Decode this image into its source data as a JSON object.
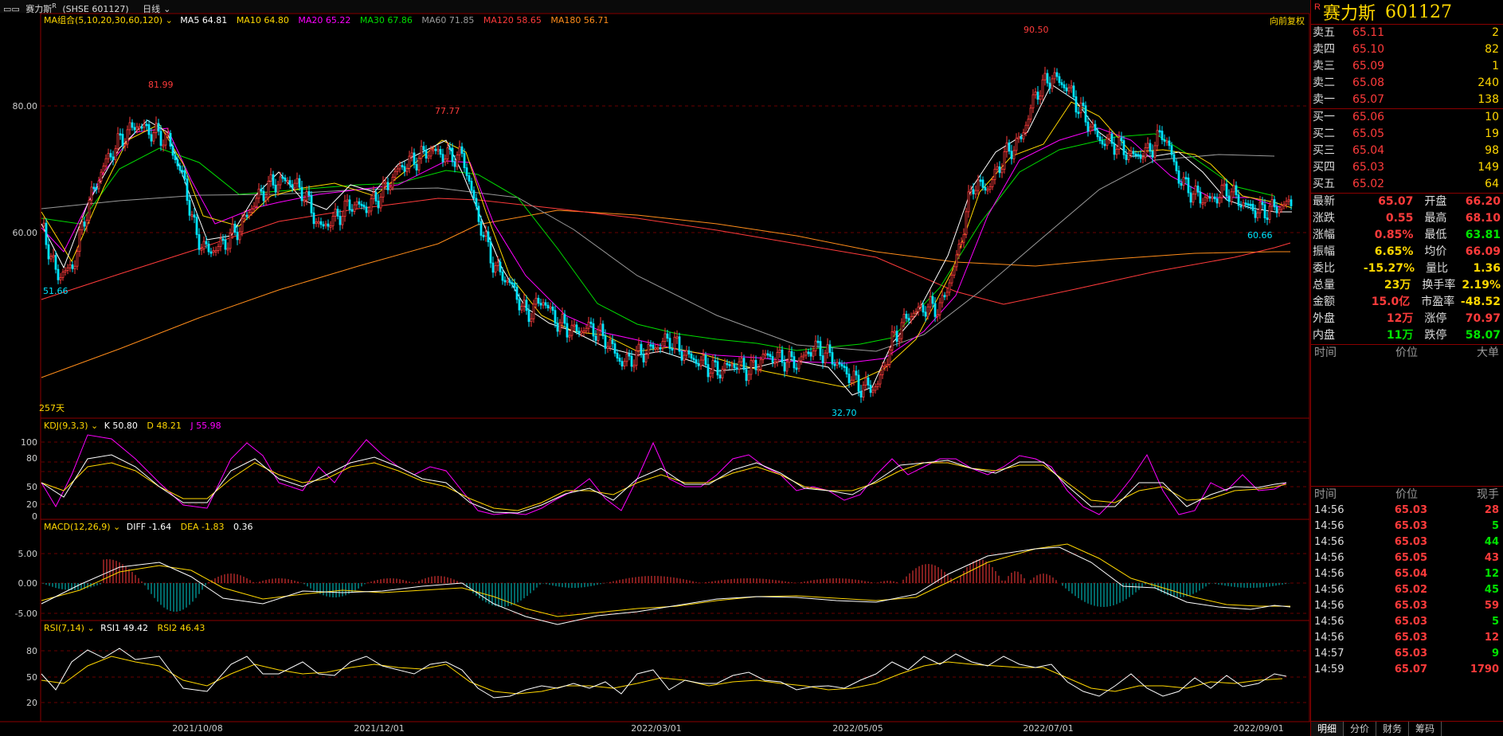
{
  "topbar": {
    "title": "赛力斯",
    "sup": "R",
    "exchange": "(SHSE 601127)",
    "period": "日线"
  },
  "main_chart": {
    "ma_group": "MA组合(5,10,20,30,60,120)",
    "ma": [
      {
        "name": "MA5",
        "value": "64.81",
        "color": "#ffffff"
      },
      {
        "name": "MA10",
        "value": "64.80",
        "color": "#ffd700"
      },
      {
        "name": "MA20",
        "value": "65.22",
        "color": "#ff00ff"
      },
      {
        "name": "MA30",
        "value": "67.86",
        "color": "#00dd00"
      },
      {
        "name": "MA60",
        "value": "71.85",
        "color": "#9a9a9a"
      },
      {
        "name": "MA120",
        "value": "58.65",
        "color": "#ff3b3b"
      },
      {
        "name": "MA180",
        "value": "56.71",
        "color": "#ff8c1a"
      }
    ],
    "adjust": "向前复权",
    "days": "257天",
    "y_labels": [
      "80.00",
      "60.00"
    ],
    "peaks": {
      "p1": "81.99",
      "p2": "77.77",
      "p3": "90.50",
      "low1": "51.66",
      "low2": "32.70",
      "last_low": "60.66"
    },
    "x_labels": [
      "2021/10/08",
      "2021/12/01",
      "2022/03/01",
      "2022/05/05",
      "2022/07/01",
      "2022/09/01"
    ]
  },
  "kdj": {
    "title": "KDJ(9,3,3)",
    "k": "K 50.80",
    "d": "D 48.21",
    "j": "J 55.98",
    "y_labels": [
      "100",
      "80",
      "50",
      "20",
      "0"
    ]
  },
  "macd": {
    "title": "MACD(12,26,9)",
    "diff": "DIFF -1.64",
    "dea": "DEA -1.83",
    "macd": "0.36",
    "y_labels": [
      "5.00",
      "0.00",
      "-5.00"
    ]
  },
  "rsi": {
    "title": "RSI(7,14)",
    "rsi1": "RSI1 49.42",
    "rsi2": "RSI2 46.43",
    "y_labels": [
      "80",
      "50",
      "20"
    ]
  },
  "chart_data": {
    "type": "candlestick",
    "ylim": [
      32.7,
      90.5
    ],
    "series": [
      {
        "name": "MA5",
        "values": [
          64.81
        ]
      },
      {
        "name": "MA10",
        "values": [
          64.8
        ]
      },
      {
        "name": "MA20",
        "values": [
          65.22
        ]
      },
      {
        "name": "MA30",
        "values": [
          67.86
        ]
      },
      {
        "name": "MA60",
        "values": [
          71.85
        ]
      },
      {
        "name": "MA120",
        "values": [
          58.65
        ]
      },
      {
        "name": "MA180",
        "values": [
          56.71
        ]
      }
    ],
    "highs": [
      81.99,
      77.77,
      90.5
    ],
    "lows": [
      51.66,
      32.7,
      60.66
    ]
  },
  "stock": {
    "sup": "R",
    "name": "赛力斯",
    "code": "601127"
  },
  "orderbook": {
    "asks": [
      {
        "label": "卖五",
        "price": "65.11",
        "vol": "2"
      },
      {
        "label": "卖四",
        "price": "65.10",
        "vol": "82"
      },
      {
        "label": "卖三",
        "price": "65.09",
        "vol": "1"
      },
      {
        "label": "卖二",
        "price": "65.08",
        "vol": "240"
      },
      {
        "label": "卖一",
        "price": "65.07",
        "vol": "138"
      }
    ],
    "bids": [
      {
        "label": "买一",
        "price": "65.06",
        "vol": "10"
      },
      {
        "label": "买二",
        "price": "65.05",
        "vol": "19"
      },
      {
        "label": "买三",
        "price": "65.04",
        "vol": "98"
      },
      {
        "label": "买四",
        "price": "65.03",
        "vol": "149"
      },
      {
        "label": "买五",
        "price": "65.02",
        "vol": "64"
      }
    ]
  },
  "quote": [
    {
      "l1": "最新",
      "v1": "65.07",
      "c1": "red",
      "l2": "开盘",
      "v2": "66.20",
      "c2": "red"
    },
    {
      "l1": "涨跌",
      "v1": "0.55",
      "c1": "red",
      "l2": "最高",
      "v2": "68.10",
      "c2": "red"
    },
    {
      "l1": "涨幅",
      "v1": "0.85%",
      "c1": "red",
      "l2": "最低",
      "v2": "63.81",
      "c2": "green"
    },
    {
      "l1": "振幅",
      "v1": "6.65%",
      "c1": "yellow",
      "l2": "均价",
      "v2": "66.09",
      "c2": "red"
    },
    {
      "l1": "委比",
      "v1": "-15.27%",
      "c1": "yellow",
      "l2": "量比",
      "v2": "1.36",
      "c2": "yellow"
    },
    {
      "l1": "总量",
      "v1": "23万",
      "c1": "yellow",
      "l2": "换手率",
      "v2": "2.19%",
      "c2": "yellow"
    },
    {
      "l1": "金额",
      "v1": "15.0亿",
      "c1": "red",
      "l2": "市盈率",
      "v2": "-48.52",
      "c2": "yellow"
    },
    {
      "l1": "外盘",
      "v1": "12万",
      "c1": "red",
      "l2": "涨停",
      "v2": "70.97",
      "c2": "red"
    },
    {
      "l1": "内盘",
      "v1": "11万",
      "c1": "green",
      "l2": "跌停",
      "v2": "58.07",
      "c2": "green"
    }
  ],
  "bigorder_header": {
    "time": "时间",
    "price": "价位",
    "big": "大单"
  },
  "tick_header": {
    "time": "时间",
    "price": "价位",
    "vol": "现手"
  },
  "ticks": [
    {
      "time": "14:56",
      "price": "65.03",
      "vol": "28",
      "color": "red"
    },
    {
      "time": "14:56",
      "price": "65.03",
      "vol": "5",
      "color": "green"
    },
    {
      "time": "14:56",
      "price": "65.03",
      "vol": "44",
      "color": "green"
    },
    {
      "time": "14:56",
      "price": "65.05",
      "vol": "43",
      "color": "red"
    },
    {
      "time": "14:56",
      "price": "65.04",
      "vol": "12",
      "color": "green"
    },
    {
      "time": "14:56",
      "price": "65.02",
      "vol": "45",
      "color": "green"
    },
    {
      "time": "14:56",
      "price": "65.03",
      "vol": "59",
      "color": "red"
    },
    {
      "time": "14:56",
      "price": "65.03",
      "vol": "5",
      "color": "green"
    },
    {
      "time": "14:56",
      "price": "65.03",
      "vol": "12",
      "color": "red"
    },
    {
      "time": "14:57",
      "price": "65.03",
      "vol": "9",
      "color": "green"
    },
    {
      "time": "14:59",
      "price": "65.07",
      "vol": "1790",
      "color": "red"
    }
  ],
  "tabs": [
    "明细",
    "分价",
    "财务",
    "筹码"
  ]
}
